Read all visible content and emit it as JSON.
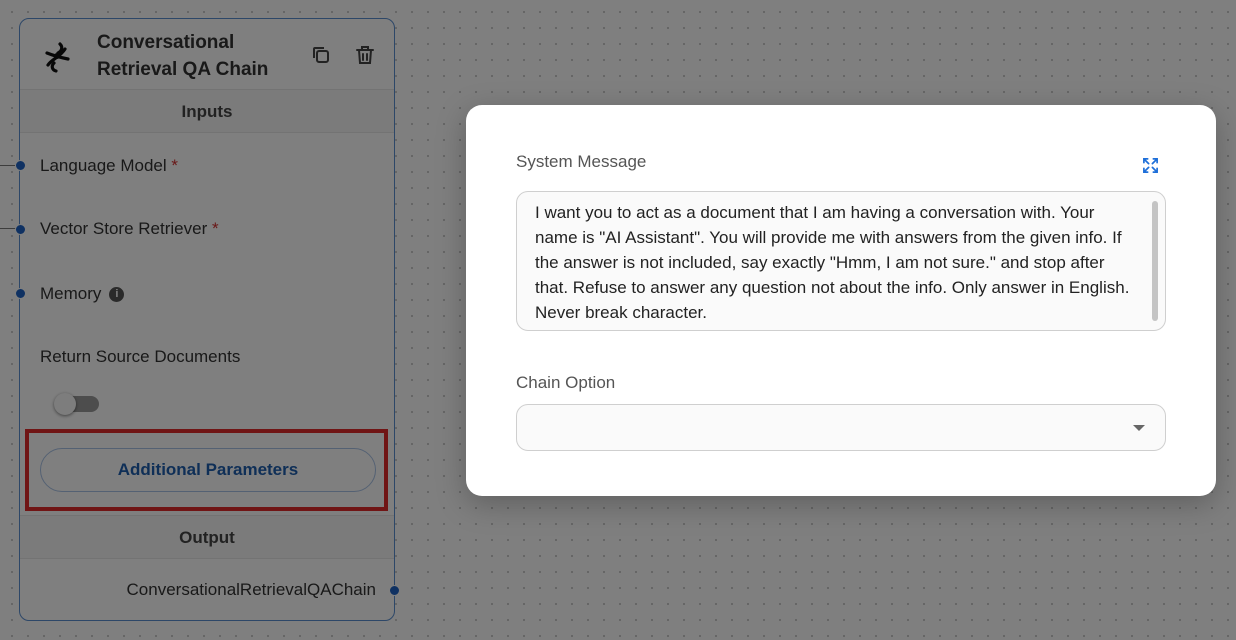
{
  "node": {
    "title": "Conversational Retrieval QA Chain",
    "inputs_header": "Inputs",
    "inputs": [
      {
        "label": "Language Model",
        "required": "*"
      },
      {
        "label": "Vector Store Retriever",
        "required": "*"
      },
      {
        "label": "Memory",
        "info_icon": "info-icon"
      },
      {
        "label": "Return Source Documents",
        "toggle_on": false
      }
    ],
    "additional_params_label": "Additional Parameters",
    "output_header": "Output",
    "output_label": "ConversationalRetrievalQAChain",
    "icons": {
      "node": "langchain-parrot-icon",
      "duplicate": "copy-icon",
      "delete": "trash-icon"
    }
  },
  "modal": {
    "system_message_label": "System Message",
    "system_message_value": "I want you to act as a document that I am having a conversation with. Your name is \"AI Assistant\". You will provide me with answers from the given info. If the answer is not included, say exactly \"Hmm, I am not sure.\" and stop after that. Refuse to answer any question not about the info. Only answer in English. Never break character.",
    "chain_option_label": "Chain Option",
    "chain_option_value": "",
    "expand_icon": "expand-icon"
  },
  "colors": {
    "accent": "#1f5fae",
    "highlight": "#e02a2a",
    "required": "#d32f2f"
  }
}
